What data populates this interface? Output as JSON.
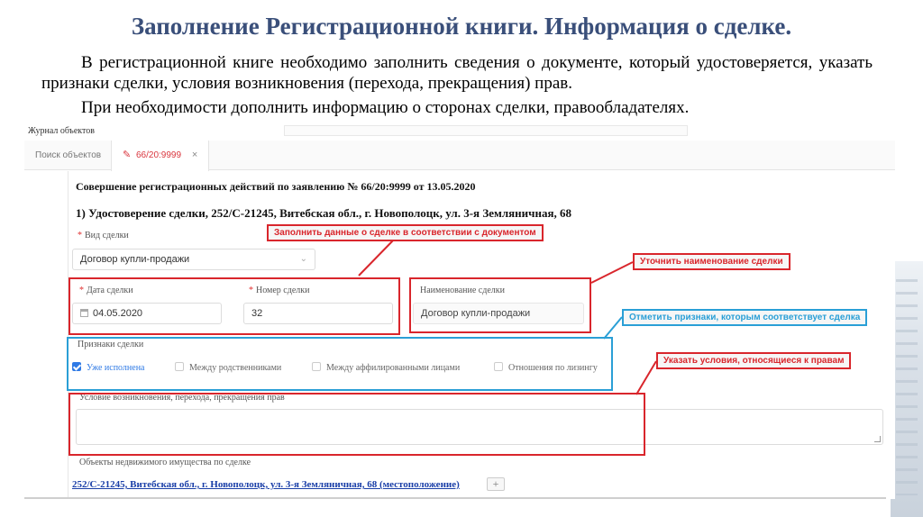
{
  "slide": {
    "title": "Заполнение Регистрационной книги. Информация о сделке.",
    "paragraph1": "В регистрационной книге необходимо заполнить сведения о документе, который удостоверяется, указать признаки сделки, условия возникновения (перехода, прекращения) прав.",
    "paragraph2": "При необходимости дополнить информацию о сторонах сделки, правообладателях."
  },
  "app": {
    "journal_title": "Журнал объектов",
    "tabs": [
      {
        "label": "Поиск объектов"
      },
      {
        "label": "66/20:9999"
      }
    ],
    "close_glyph": "×",
    "pen_glyph": "✎"
  },
  "form": {
    "heading": "Совершение регистрационных действий по заявлению № 66/20:9999 от 13.05.2020",
    "subheading": "1) Удостоверение сделки, 252/С-21245, Витебская обл., г. Новополоцк, ул. 3-я Земляничная, 68",
    "deal_type": {
      "label": "Вид сделки",
      "value": "Договор купли-продажи",
      "required_mark": "*"
    },
    "deal_date": {
      "label": "Дата сделки",
      "value": "04.05.2020",
      "required_mark": "*"
    },
    "deal_number": {
      "label": "Номер сделки",
      "value": "32",
      "required_mark": "*"
    },
    "deal_name": {
      "label": "Наименование сделки",
      "value": "Договор купли-продажи"
    },
    "signs": {
      "label": "Признаки сделки",
      "options": [
        {
          "label": "Уже исполнена",
          "checked": true
        },
        {
          "label": "Между родственниками",
          "checked": false
        },
        {
          "label": "Между аффилированными лицами",
          "checked": false
        },
        {
          "label": "Отношения по лизингу",
          "checked": false
        }
      ]
    },
    "conditions": {
      "label": "Условие возникновения, перехода, прекращения прав",
      "value": ""
    },
    "objects": {
      "label": "Объекты недвижимого имущества по сделке",
      "link": "252/С-21245, Витебская обл., г. Новополоцк, ул. 3-я Земляничная, 68 (местоположение)",
      "add_glyph": "+"
    }
  },
  "callouts": {
    "fill_deal": "Заполнить данные о сделке в соответствии с документом",
    "specify_name": "Уточнить наименование сделки",
    "mark_signs": "Отметить признаки, которым соответствует сделка",
    "specify_conditions": "Указать условия, относящиеся к правам"
  },
  "colors": {
    "title": "#3a4f7a",
    "highlight_red": "#d9262c",
    "highlight_blue": "#2a9fd6",
    "link": "#1a3fa8",
    "checkbox": "#2f7ae5"
  }
}
